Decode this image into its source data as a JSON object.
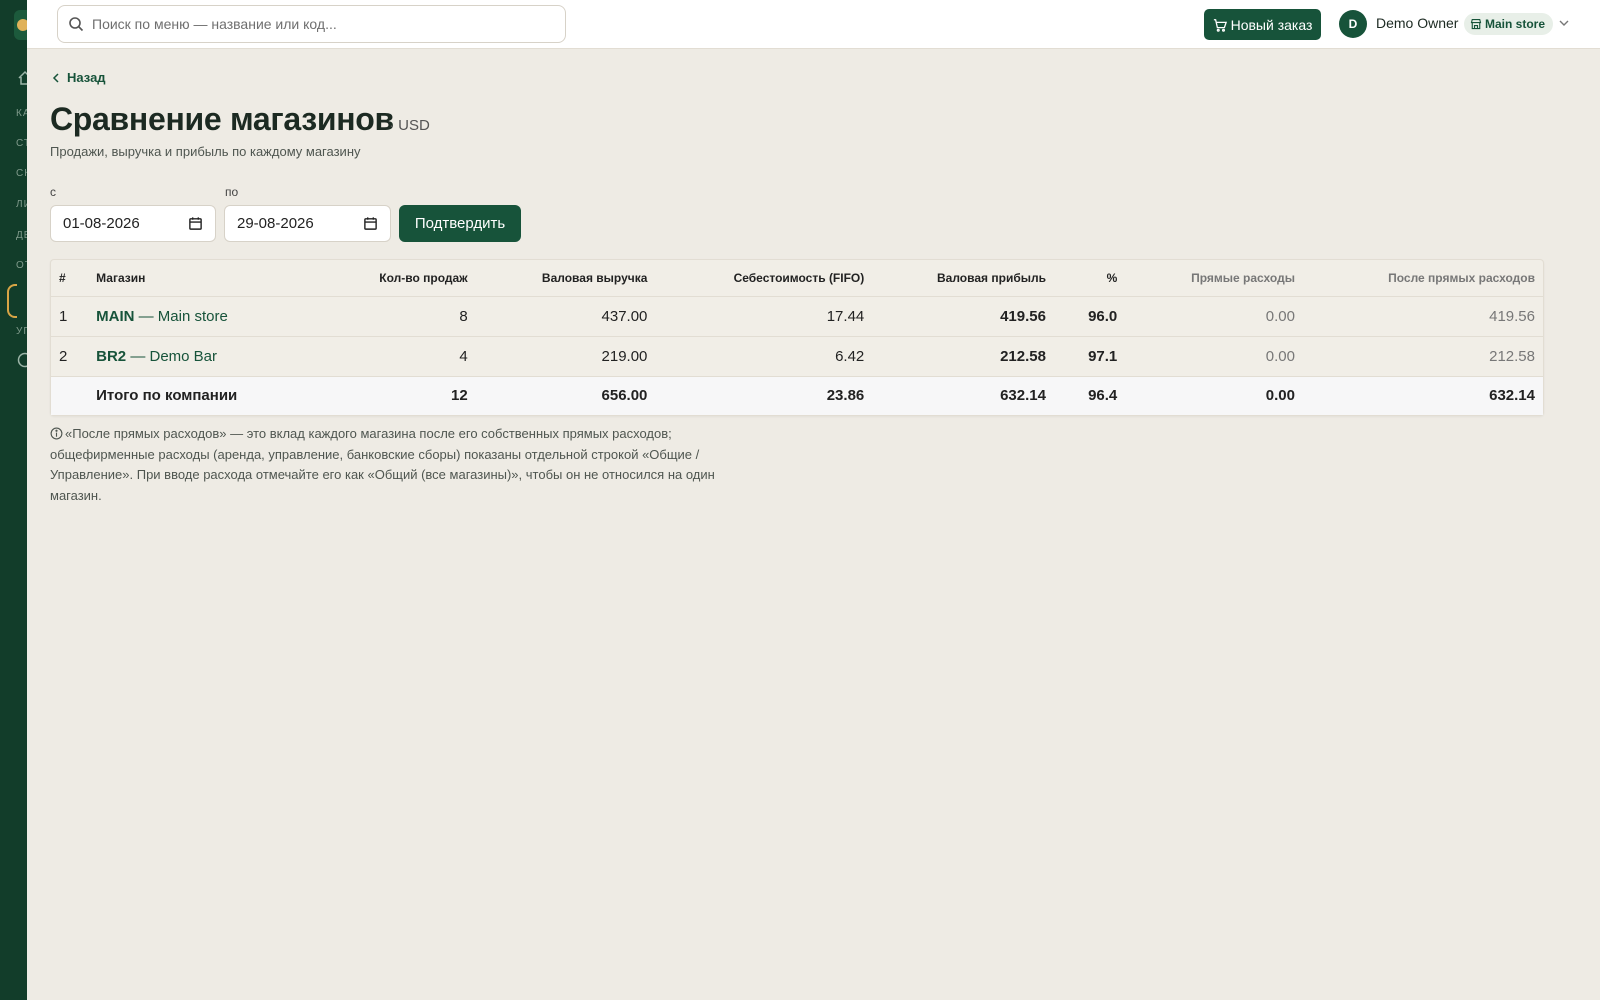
{
  "sidebar": {
    "labels": [
      "КА",
      "СТ",
      "СК",
      "ЛИ",
      "ДЕ",
      "ОТ",
      "УП"
    ]
  },
  "topbar": {
    "search_placeholder": "Поиск по меню — название или код...",
    "new_order_label": "Новый заказ",
    "avatar_initial": "D",
    "user_name": "Demo Owner",
    "store_name": "Main store"
  },
  "page": {
    "back_label": "Назад",
    "title": "Сравнение магазинов",
    "currency": "· USD",
    "subtitle": "Продажи, выручка и прибыль по каждому магазину"
  },
  "filters": {
    "from_label": "с",
    "from_value": "01-08-2026",
    "to_label": "по",
    "to_value": "29-08-2026",
    "confirm_label": "Подтвердить"
  },
  "table": {
    "headers": [
      "#",
      "Магазин",
      "Кол-во продаж",
      "Валовая выручка",
      "Себестоимость (FIFO)",
      "Валовая прибыль",
      "%",
      "Прямые расходы",
      "После прямых расходов"
    ],
    "rows": [
      {
        "num": "1",
        "code": "MAIN",
        "name": " — Main store",
        "sales": "8",
        "revenue": "437.00",
        "cogs": "17.44",
        "profit": "419.56",
        "pct": "96.0",
        "direct": "0.00",
        "after": "419.56"
      },
      {
        "num": "2",
        "code": "BR2",
        "name": " — Demo Bar",
        "sales": "4",
        "revenue": "219.00",
        "cogs": "6.42",
        "profit": "212.58",
        "pct": "97.1",
        "direct": "0.00",
        "after": "212.58"
      }
    ],
    "total": {
      "label": "Итого по компании",
      "sales": "12",
      "revenue": "656.00",
      "cogs": "23.86",
      "profit": "632.14",
      "pct": "96.4",
      "direct": "0.00",
      "after": "632.14"
    }
  },
  "note": "«После прямых расходов» — это вклад каждого магазина после его собственных прямых расходов; общефирменные расходы (аренда, управление, банковские сборы) показаны отдельной строкой «Общие / Управление». При вводе расхода отмечайте его как «Общий (все магазины)», чтобы он не относился на один магазин."
}
